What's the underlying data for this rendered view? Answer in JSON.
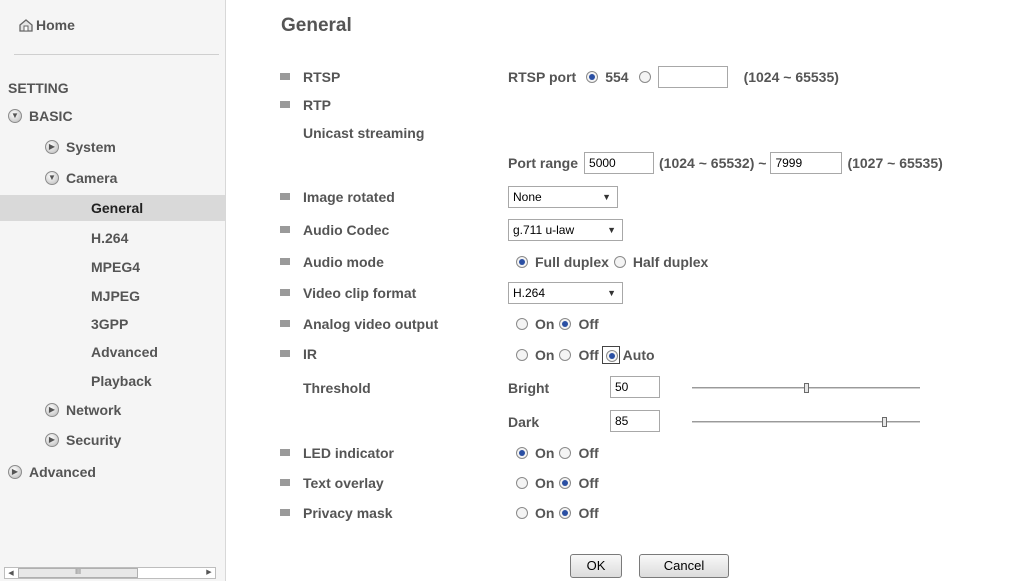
{
  "sidebar": {
    "home": "Home",
    "setting": "SETTING",
    "basic": "BASIC",
    "system": "System",
    "camera": "Camera",
    "general": "General",
    "h264": "H.264",
    "mpeg4": "MPEG4",
    "mjpeg": "MJPEG",
    "3gpp": "3GPP",
    "advanced_sub": "Advanced",
    "playback": "Playback",
    "network": "Network",
    "security": "Security",
    "advanced": "Advanced",
    "scrollbar_grip": "III"
  },
  "page": {
    "title": "General"
  },
  "rtsp": {
    "label": "RTSP",
    "port_label": "RTSP port",
    "default_port": "554",
    "custom_port": "",
    "range": "(1024 ~ 65535)"
  },
  "rtp": {
    "label": "RTP",
    "unicast_label": "Unicast streaming",
    "port_range_label": "Port range",
    "port_start": "5000",
    "start_range": "(1024 ~ 65532) ~",
    "port_end": "7999",
    "end_range": "(1027 ~ 65535)"
  },
  "image_rotated": {
    "label": "Image rotated",
    "value": "None"
  },
  "audio_codec": {
    "label": "Audio Codec",
    "value": "g.711 u-law"
  },
  "audio_mode": {
    "label": "Audio mode",
    "full": "Full duplex",
    "half": "Half duplex",
    "selected": "full"
  },
  "video_clip_format": {
    "label": "Video clip format",
    "value": "H.264"
  },
  "analog_video_output": {
    "label": "Analog video output",
    "on": "On",
    "off": "Off",
    "selected": "off"
  },
  "ir": {
    "label": "IR",
    "on": "On",
    "off": "Off",
    "auto": "Auto",
    "selected": "auto",
    "threshold_label": "Threshold",
    "bright_label": "Bright",
    "bright_value": "50",
    "bright_level": 0.5,
    "dark_label": "Dark",
    "dark_value": "85",
    "dark_level": 0.85
  },
  "led_indicator": {
    "label": "LED indicator",
    "on": "On",
    "off": "Off",
    "selected": "on"
  },
  "text_overlay": {
    "label": "Text overlay",
    "on": "On",
    "off": "Off",
    "selected": "off"
  },
  "privacy_mask": {
    "label": "Privacy mask",
    "on": "On",
    "off": "Off",
    "selected": "off"
  },
  "buttons": {
    "ok": "OK",
    "cancel": "Cancel"
  },
  "colors": {
    "sidebar_bg": "#f5f5f5",
    "active_bg": "#d9d9d9",
    "text": "#555555",
    "radio_dot": "#2a4fa3"
  }
}
